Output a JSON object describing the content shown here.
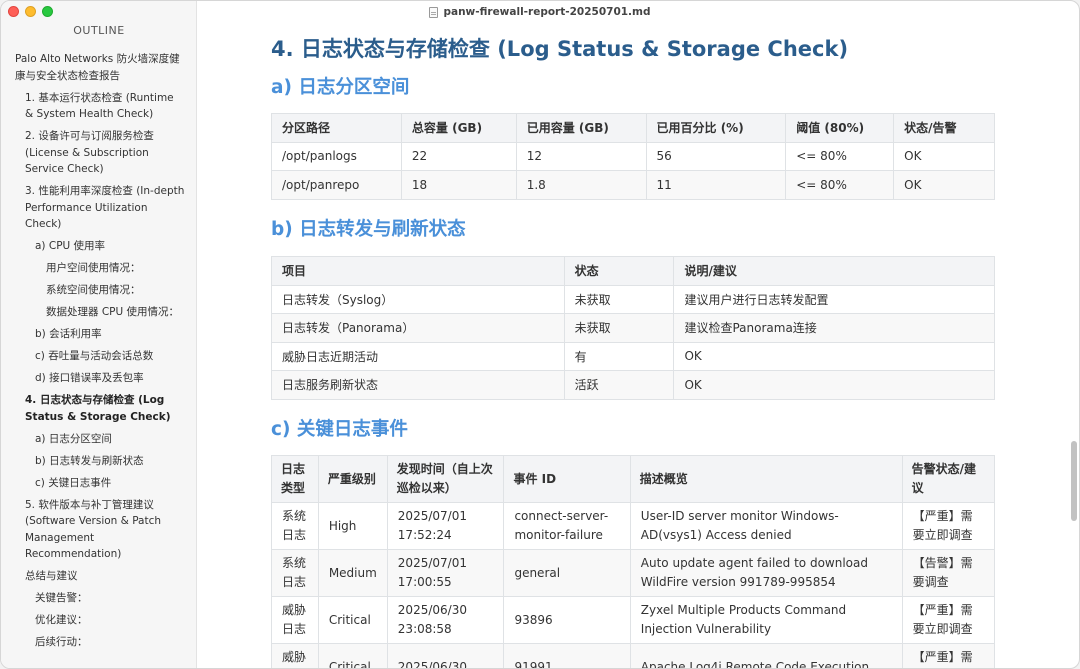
{
  "window": {
    "title": "panw-firewall-report-20250701.md"
  },
  "outline": {
    "heading": "OUTLINE",
    "items": [
      {
        "level": 1,
        "label": "Palo Alto Networks 防火墙深度健康与安全状态检查报告"
      },
      {
        "level": 2,
        "label": "1. 基本运行状态检查 (Runtime & System Health Check)"
      },
      {
        "level": 2,
        "label": "2. 设备许可与订阅服务检查 (License & Subscription Service Check)"
      },
      {
        "level": 2,
        "label": "3. 性能利用率深度检查 (In-depth Performance Utilization Check)"
      },
      {
        "level": 3,
        "label": "a) CPU 使用率"
      },
      {
        "level": 4,
        "label": "用户空间使用情况："
      },
      {
        "level": 4,
        "label": "系统空间使用情况："
      },
      {
        "level": 4,
        "label": "数据处理器 CPU 使用情况："
      },
      {
        "level": 3,
        "label": "b) 会话利用率"
      },
      {
        "level": 3,
        "label": "c) 吞吐量与活动会话总数"
      },
      {
        "level": 3,
        "label": "d) 接口错误率及丢包率"
      },
      {
        "level": 2,
        "label": "4. 日志状态与存储检查 (Log Status & Storage Check)",
        "active": true
      },
      {
        "level": 3,
        "label": "a) 日志分区空间"
      },
      {
        "level": 3,
        "label": "b) 日志转发与刷新状态"
      },
      {
        "level": 3,
        "label": "c) 关键日志事件"
      },
      {
        "level": 2,
        "label": "5. 软件版本与补丁管理建议 (Software Version & Patch Management Recommendation)"
      },
      {
        "level": 2,
        "label": "总结与建议"
      },
      {
        "level": 3,
        "label": "关键告警："
      },
      {
        "level": 3,
        "label": "优化建议："
      },
      {
        "level": 3,
        "label": "后续行动："
      }
    ]
  },
  "doc": {
    "h1": "4. 日志状态与存储检查 (Log Status & Storage Check)",
    "sec_a": {
      "title": "a) 日志分区空间",
      "headers": [
        "分区路径",
        "总容量 (GB)",
        "已用容量 (GB)",
        "已用百分比 (%)",
        "阈值 (80%)",
        "状态/告警"
      ],
      "rows": [
        [
          "/opt/panlogs",
          "22",
          "12",
          "56",
          "<= 80%",
          "OK"
        ],
        [
          "/opt/panrepo",
          "18",
          "1.8",
          "11",
          "<= 80%",
          "OK"
        ]
      ]
    },
    "sec_b": {
      "title": "b) 日志转发与刷新状态",
      "headers": [
        "项目",
        "状态",
        "说明/建议"
      ],
      "rows": [
        [
          "日志转发（Syslog）",
          "未获取",
          "建议用户进行日志转发配置"
        ],
        [
          "日志转发（Panorama）",
          "未获取",
          "建议检查Panorama连接"
        ],
        [
          "威胁日志近期活动",
          "有",
          "OK"
        ],
        [
          "日志服务刷新状态",
          "活跃",
          "OK"
        ]
      ]
    },
    "sec_c": {
      "title": "c) 关键日志事件",
      "headers": [
        "日志类型",
        "严重级别",
        "发现时间（自上次巡检以来）",
        "事件 ID",
        "描述概览",
        "告警状态/建议"
      ],
      "rows": [
        [
          "系统日志",
          "High",
          "2025/07/01 17:52:24",
          "connect-server-monitor-failure",
          "User-ID server monitor Windows-AD(vsys1) Access denied",
          "【严重】需要立即调查"
        ],
        [
          "系统日志",
          "Medium",
          "2025/07/01 17:00:55",
          "general",
          "Auto update agent failed to download WildFire version 991789-995854",
          "【告警】需要调查"
        ],
        [
          "威胁日志",
          "Critical",
          "2025/06/30 23:08:58",
          "93896",
          "Zyxel Multiple Products Command Injection Vulnerability",
          "【严重】需要立即调查"
        ],
        [
          "威胁日志",
          "Critical",
          "2025/06/30",
          "91991",
          "Apache Log4j Remote Code Execution",
          "【严重】需要"
        ]
      ]
    }
  },
  "colors": {
    "h1": "#2b5d8c",
    "h2": "#4a90d9",
    "sidebar_bg": "#f6f6f6",
    "table_header_bg": "#f3f4f6",
    "border": "#dfe2e5"
  }
}
